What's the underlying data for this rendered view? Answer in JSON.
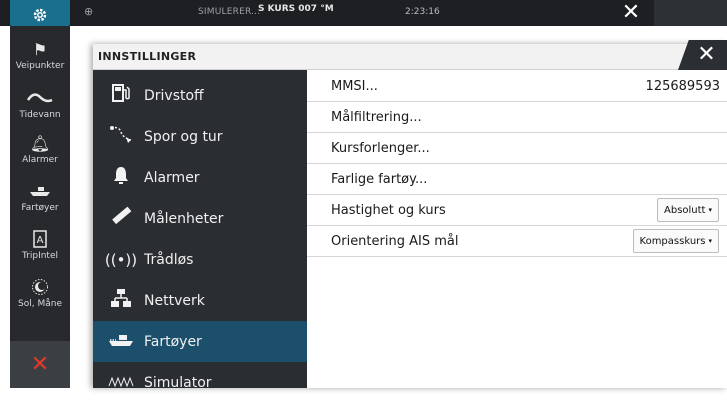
{
  "statusbar": {
    "sim_text": "SIMULERER...",
    "kurs_badge": "S KURS 007 °M",
    "time": "2:23:16"
  },
  "toolbar": {
    "items": [
      {
        "label": "Veipunkter",
        "icon": "flag-icon"
      },
      {
        "label": "Tidevann",
        "icon": "tide-wave-icon"
      },
      {
        "label": "Alarmer",
        "icon": "bell-icon"
      },
      {
        "label": "Fartøyer",
        "icon": "vessels-icon"
      },
      {
        "label": "TripIntel",
        "icon": "tripintel-icon"
      },
      {
        "label": "Sol, Måne",
        "icon": "sun-moon-icon"
      }
    ]
  },
  "dialog": {
    "title": "INNSTILLINGER",
    "categories": [
      {
        "label": "Drivstoff",
        "icon": "fuel-pump-icon"
      },
      {
        "label": "Spor og tur",
        "icon": "track-icon"
      },
      {
        "label": "Alarmer",
        "icon": "bell-icon"
      },
      {
        "label": "Målenheter",
        "icon": "ruler-icon"
      },
      {
        "label": "Trådløs",
        "icon": "wireless-icon"
      },
      {
        "label": "Nettverk",
        "icon": "network-icon"
      },
      {
        "label": "Fartøyer",
        "icon": "vessels-icon"
      },
      {
        "label": "Simulator",
        "icon": "simulator-icon"
      }
    ],
    "selected_category": "Fartøyer",
    "settings": [
      {
        "label": "MMSI...",
        "value": "125689593"
      },
      {
        "label": "Målfiltrering..."
      },
      {
        "label": "Kursforlenger..."
      },
      {
        "label": "Farlige fartøy..."
      },
      {
        "label": "Hastighet og kurs",
        "dropdown": "Absolutt"
      },
      {
        "label": "Orientering AIS mål",
        "dropdown": "Kompasskurs"
      }
    ]
  },
  "colors": {
    "accent": "#1a6f8f",
    "selected_bg": "#1b4f6b",
    "panel_dark": "#2a2d31",
    "close_red": "#e23a2a"
  }
}
